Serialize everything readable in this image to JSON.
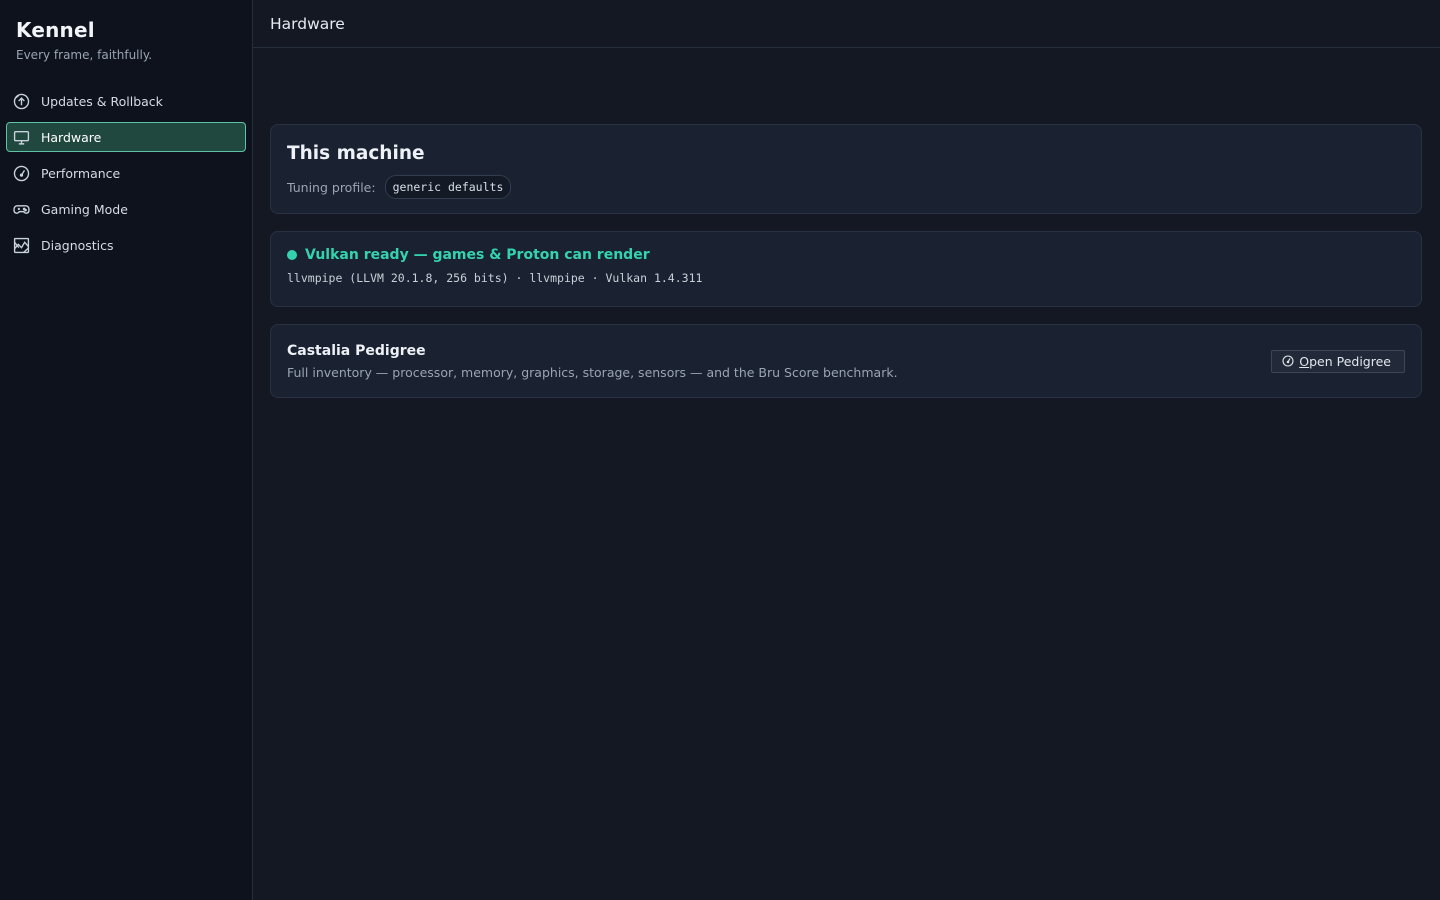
{
  "app": {
    "title": "Kennel",
    "tagline": "Every frame, faithfully."
  },
  "sidebar": {
    "items": [
      {
        "label": "Updates & Rollback",
        "icon": "update-arrow-icon",
        "active": false
      },
      {
        "label": "Hardware",
        "icon": "monitor-icon",
        "active": true
      },
      {
        "label": "Performance",
        "icon": "gauge-icon",
        "active": false
      },
      {
        "label": "Gaming Mode",
        "icon": "gamepad-icon",
        "active": false
      },
      {
        "label": "Diagnostics",
        "icon": "chart-icon",
        "active": false
      }
    ]
  },
  "header": {
    "title": "Hardware"
  },
  "machine": {
    "title": "This machine",
    "profile_label": "Tuning profile:",
    "profile_value": "generic defaults"
  },
  "vulkan": {
    "status": "Vulkan ready — games & Proton can render",
    "status_color": "#34d3b0",
    "detail": "llvmpipe (LLVM 20.1.8, 256 bits) · llvmpipe · Vulkan 1.4.311"
  },
  "pedigree": {
    "title": "Castalia Pedigree",
    "description": "Full inventory — processor, memory, graphics, storage, sensors — and the Bru Score benchmark.",
    "button_label": "Open Pedigree",
    "button_icon": "pedigree-icon"
  },
  "colors": {
    "accent": "#5ec2a8",
    "active_bg": "#20483f"
  }
}
